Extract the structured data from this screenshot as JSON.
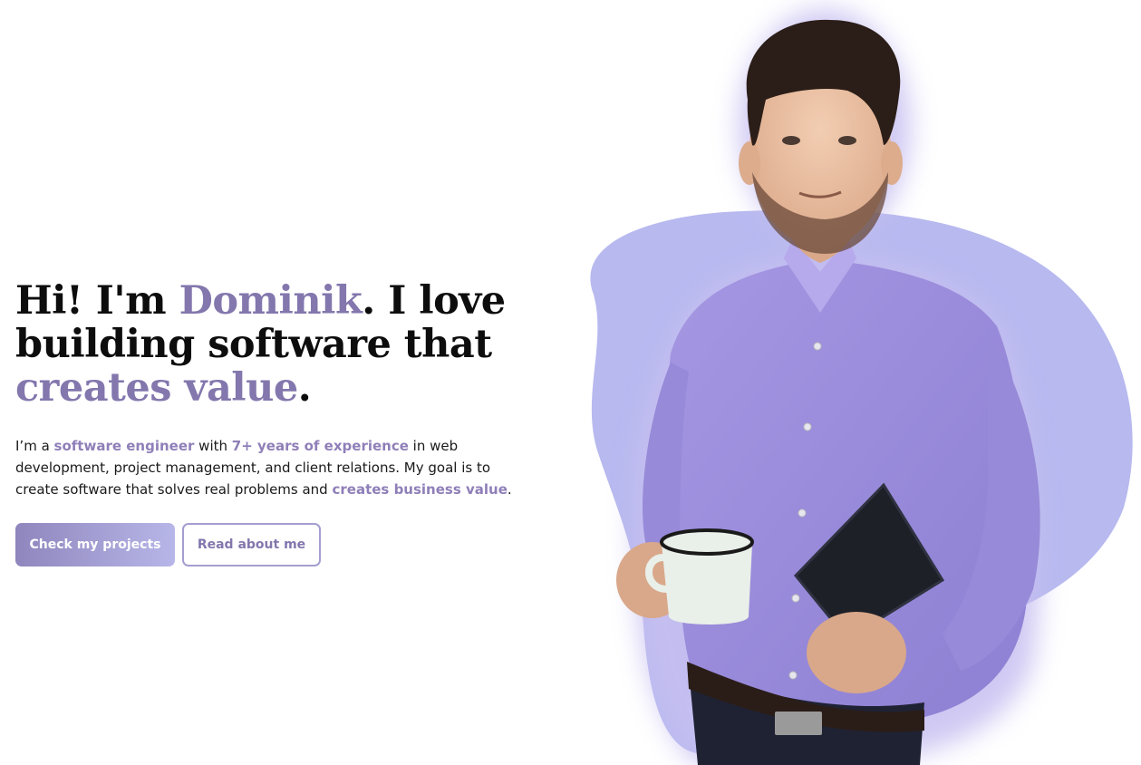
{
  "hero": {
    "headline": {
      "part1": "Hi! I'm ",
      "name": "Dominik",
      "part2": ". I love building software that ",
      "highlight": "creates value",
      "part3": "."
    },
    "intro": {
      "t1": "I’m a ",
      "h1": "software engineer",
      "t2": " with ",
      "h2": "7+ years of experience",
      "t3": " in web development, project management, and client relations. My goal is to create software that solves real problems and ",
      "h3": "creates business value",
      "t4": "."
    },
    "buttons": {
      "primary": "Check my projects",
      "secondary": "Read about me"
    }
  },
  "colors": {
    "accent": "#8377ad",
    "blob": "#b7b9ef",
    "shirt": "#9c8edc"
  },
  "portrait": {
    "icon": "person-photo"
  }
}
